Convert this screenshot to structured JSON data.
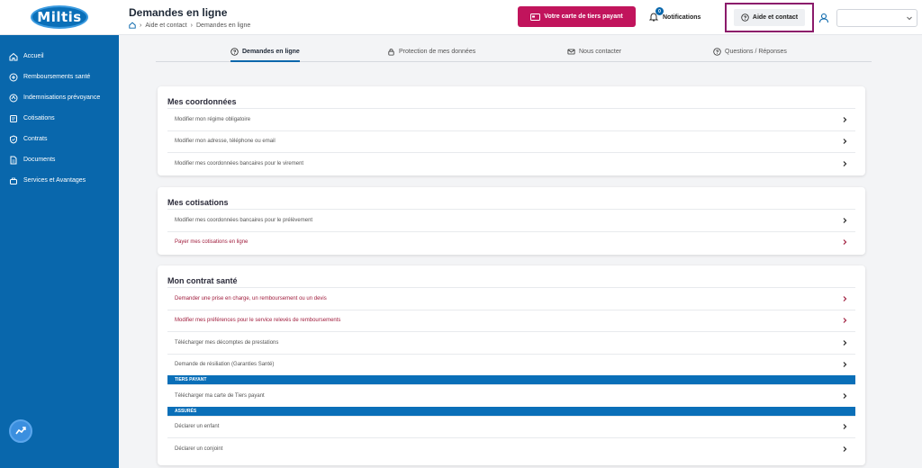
{
  "brand": {
    "logo_text": "Miltis",
    "primary": "#0967ac",
    "accent": "#c1145c",
    "highlight": "#8b1a6b"
  },
  "sidebar": {
    "items": [
      {
        "label": "Accueil",
        "icon": "home-icon"
      },
      {
        "label": "Remboursements santé",
        "icon": "refund-icon"
      },
      {
        "label": "Indemnisations prévoyance",
        "icon": "compensation-icon"
      },
      {
        "label": "Cotisations",
        "icon": "contribution-icon"
      },
      {
        "label": "Contrats",
        "icon": "shield-icon"
      },
      {
        "label": "Documents",
        "icon": "document-icon"
      },
      {
        "label": "Services et Avantages",
        "icon": "services-icon"
      }
    ]
  },
  "header": {
    "title": "Demandes en ligne",
    "breadcrumb": [
      "Aide et contact",
      "Demandes en ligne"
    ],
    "card_button": "Votre carte de tiers payant",
    "notifications_label": "Notifications",
    "notifications_count": "0",
    "help_button": "Aide et contact"
  },
  "tabs": [
    {
      "label": "Demandes en ligne",
      "icon": "question-icon",
      "active": true
    },
    {
      "label": "Protection de mes données",
      "icon": "lock-icon",
      "active": false
    },
    {
      "label": "Nous contacter",
      "icon": "mail-icon",
      "active": false
    },
    {
      "label": "Questions / Réponses",
      "icon": "question-icon",
      "active": false
    }
  ],
  "cards": {
    "coordonnees": {
      "title": "Mes coordonnées",
      "rows": [
        "Modifier mon régime obligatoire",
        "Modifier mon adresse, téléphone ou email",
        "Modifier mes coordonnées bancaires pour le virement"
      ]
    },
    "cotisations": {
      "title": "Mes cotisations",
      "rows": [
        "Modifier mes coordonnées bancaires pour le prélèvement",
        "Payer mes cotisations en ligne"
      ]
    },
    "contrat": {
      "title": "Mon contrat santé",
      "rows": [
        "Demander une prise en charge, un remboursement ou un devis",
        "Modifier mes préférences pour le service relevés de remboursements",
        "Télécharger mes décomptes de prestations",
        "Demande de résiliation (Garanties Santé)"
      ],
      "band_tiers": "TIERS PAYANT",
      "tiers_rows": [
        "Télécharger ma carte de Tiers payant"
      ],
      "band_assures": "ASSURÉS",
      "assures_rows": [
        "Déclarer un enfant",
        "Déclarer un conjoint"
      ]
    }
  }
}
